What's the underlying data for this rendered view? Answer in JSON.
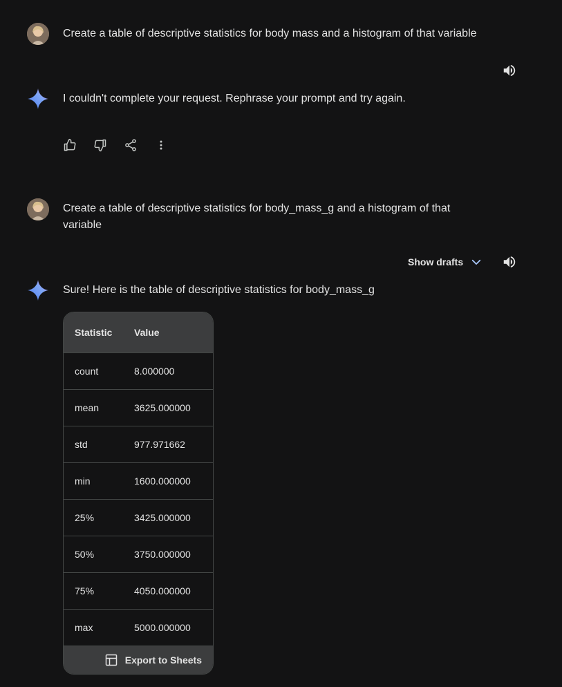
{
  "conversation": {
    "turn1": {
      "user_prompt": "Create a table of descriptive statistics for body mass and a histogram of that variable",
      "response": "I couldn't complete your request. Rephrase your prompt and try again."
    },
    "turn2": {
      "user_prompt": "Create a table of descriptive statistics for body_mass_g and a histogram of that variable",
      "show_drafts_label": "Show drafts",
      "response": "Sure! Here is the table of descriptive statistics for body_mass_g",
      "table": {
        "headers": [
          "Statistic",
          "Value"
        ],
        "rows": [
          {
            "stat": "count",
            "value": "8.000000"
          },
          {
            "stat": "mean",
            "value": "3625.000000"
          },
          {
            "stat": "std",
            "value": "977.971662"
          },
          {
            "stat": "min",
            "value": "1600.000000"
          },
          {
            "stat": "25%",
            "value": "3425.000000"
          },
          {
            "stat": "50%",
            "value": "3750.000000"
          },
          {
            "stat": "75%",
            "value": "4050.000000"
          },
          {
            "stat": "max",
            "value": "5000.000000"
          }
        ],
        "export_label": "Export to Sheets"
      }
    }
  },
  "icons": {
    "speaker": "volume-up-icon",
    "thumbs_up": "thumb-up-icon",
    "thumbs_down": "thumb-down-icon",
    "share": "share-icon",
    "more": "more-vert-icon",
    "chevron": "chevron-down-icon",
    "gemini": "gemini-sparkle-icon",
    "sheets": "table-icon"
  },
  "colors": {
    "background": "#131314",
    "text": "#e3e3e3",
    "table_header": "#3c3d3e",
    "border": "#444746",
    "chevron_accent": "#a8c7fa"
  }
}
